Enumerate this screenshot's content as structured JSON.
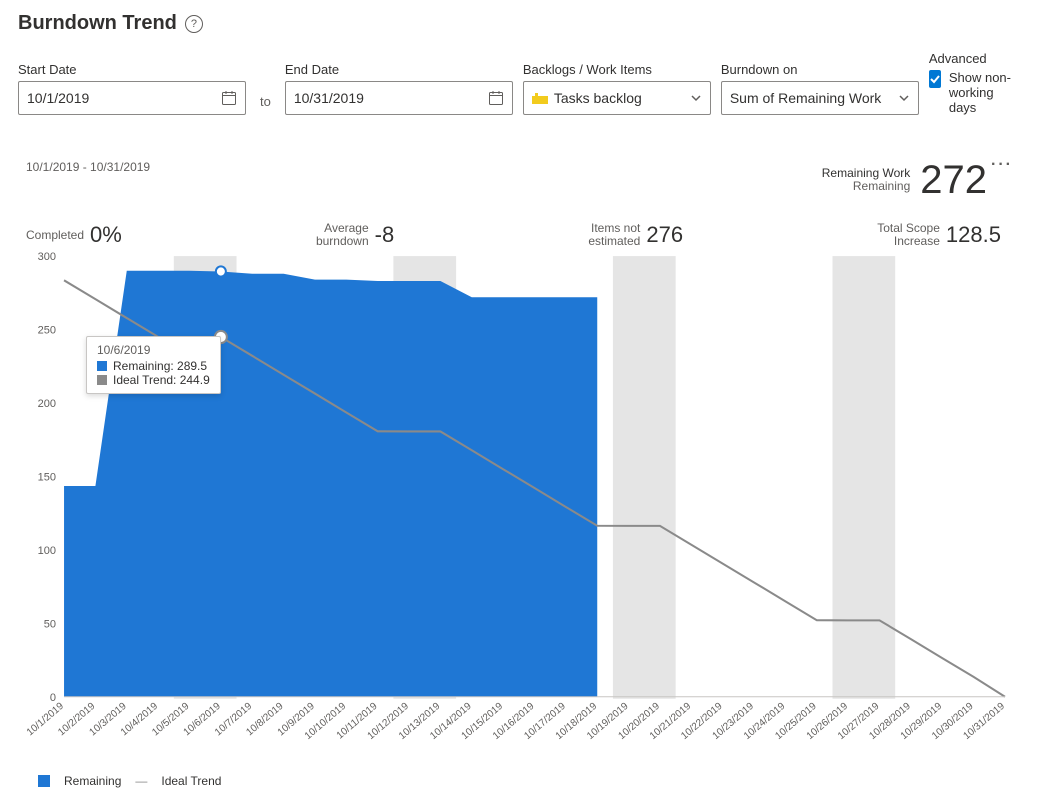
{
  "header": {
    "title": "Burndown Trend"
  },
  "controls": {
    "start_date": {
      "label": "Start Date",
      "value": "10/1/2019"
    },
    "end_date": {
      "label": "End Date",
      "value": "10/31/2019"
    },
    "to_label": "to",
    "backlogs": {
      "label": "Backlogs / Work Items",
      "value": "Tasks backlog"
    },
    "burndown_on": {
      "label": "Burndown on",
      "value": "Sum of Remaining Work"
    },
    "advanced": {
      "label": "Advanced",
      "checkbox_label": "Show non-working days",
      "checked": true
    }
  },
  "card": {
    "range_text": "10/1/2019 - 10/31/2019",
    "remaining_work": {
      "label1": "Remaining Work",
      "label2": "Remaining",
      "value": "272"
    },
    "stats": {
      "completed": {
        "label": "Completed",
        "value": "0%"
      },
      "avg_burndown": {
        "label": "Average\nburndown",
        "value": "-8"
      },
      "items_not_est": {
        "label": "Items not\nestimated",
        "value": "276"
      },
      "scope_increase": {
        "label": "Total Scope\nIncrease",
        "value": "128.5"
      }
    }
  },
  "tooltip": {
    "date": "10/6/2019",
    "remaining": "Remaining: 289.5",
    "ideal": "Ideal Trend: 244.9"
  },
  "legend": {
    "remaining": "Remaining",
    "ideal": "Ideal Trend"
  },
  "chart_data": {
    "type": "area+line",
    "title": "Burndown Trend",
    "ylim": [
      0,
      300
    ],
    "yticks": [
      0,
      50,
      100,
      150,
      200,
      250,
      300
    ],
    "categories": [
      "10/1/2019",
      "10/2/2019",
      "10/3/2019",
      "10/4/2019",
      "10/5/2019",
      "10/6/2019",
      "10/7/2019",
      "10/8/2019",
      "10/9/2019",
      "10/10/2019",
      "10/11/2019",
      "10/12/2019",
      "10/13/2019",
      "10/14/2019",
      "10/15/2019",
      "10/16/2019",
      "10/17/2019",
      "10/18/2019",
      "10/19/2019",
      "10/20/2019",
      "10/21/2019",
      "10/22/2019",
      "10/23/2019",
      "10/24/2019",
      "10/25/2019",
      "10/26/2019",
      "10/27/2019",
      "10/28/2019",
      "10/29/2019",
      "10/30/2019",
      "10/31/2019"
    ],
    "non_working_bands": [
      [
        "10/5/2019",
        "10/6/2019"
      ],
      [
        "10/12/2019",
        "10/13/2019"
      ],
      [
        "10/19/2019",
        "10/20/2019"
      ],
      [
        "10/26/2019",
        "10/27/2019"
      ]
    ],
    "series": [
      {
        "name": "Remaining",
        "kind": "area",
        "color": "#1f77d4",
        "values": [
          143.5,
          143.5,
          290,
          290,
          290,
          289.5,
          288,
          288,
          284,
          284,
          283,
          283,
          283,
          272,
          272,
          272,
          272,
          272,
          null,
          null,
          null,
          null,
          null,
          null,
          null,
          null,
          null,
          null,
          null,
          null,
          null
        ]
      },
      {
        "name": "Ideal Trend",
        "kind": "line",
        "color": "#8a8a8a",
        "values": [
          283.5,
          270.7,
          257.8,
          245.0,
          244.9,
          244.9,
          232.1,
          219.2,
          206.4,
          193.5,
          180.7,
          180.6,
          180.6,
          167.8,
          154.9,
          142.1,
          129.2,
          116.4,
          116.3,
          116.3,
          103.5,
          90.6,
          77.8,
          64.9,
          52.1,
          52.0,
          52.0,
          39.2,
          26.3,
          13.5,
          0
        ]
      }
    ],
    "highlight_point": {
      "series": "Remaining",
      "category": "10/6/2019",
      "value": 289.5
    }
  }
}
